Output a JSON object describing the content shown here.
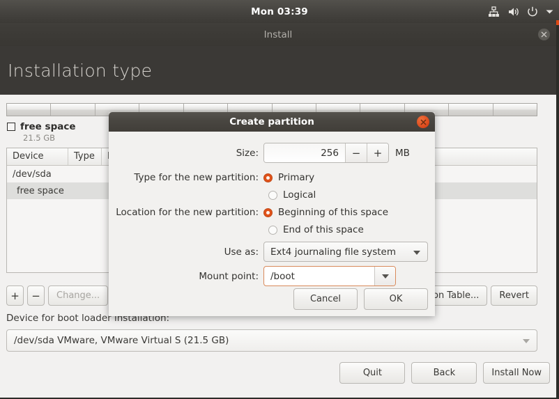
{
  "panel": {
    "clock": "Mon 03:39",
    "tray_icons": [
      "network-icon",
      "volume-icon",
      "power-icon",
      "chevron-down-icon"
    ]
  },
  "window": {
    "title": "Install",
    "close_icon": "close-icon",
    "heading": "Installation type"
  },
  "partition_bar": {
    "segments": 12,
    "free_space_label": "free space",
    "free_space_size": "21.5 GB",
    "checkbox_icon": "checkbox-unchecked-icon"
  },
  "table": {
    "columns": [
      "Device",
      "Type",
      "M"
    ],
    "rows": [
      {
        "device": "/dev/sda",
        "selected": false,
        "child": false
      },
      {
        "device": "free space",
        "selected": true,
        "child": true
      }
    ]
  },
  "toolbar": {
    "add_label": "+",
    "remove_label": "−",
    "change_label": "Change...",
    "new_partition_table_label": "ition Table...",
    "revert_label": "Revert"
  },
  "bootloader": {
    "label": "Device for boot loader installation:",
    "value": "/dev/sda VMware, VMware Virtual S (21.5 GB)",
    "arrow_icon": "chevron-down-icon"
  },
  "nav": {
    "quit": "Quit",
    "back": "Back",
    "install_now": "Install Now"
  },
  "dialog": {
    "title": "Create partition",
    "close_icon": "close-icon",
    "size": {
      "label": "Size:",
      "value": "256",
      "unit": "MB",
      "minus_label": "−",
      "plus_label": "+"
    },
    "type": {
      "label": "Type for the new partition:",
      "options": [
        {
          "label": "Primary",
          "selected": true
        },
        {
          "label": "Logical",
          "selected": false
        }
      ]
    },
    "location": {
      "label": "Location for the new partition:",
      "options": [
        {
          "label": "Beginning of this space",
          "selected": true
        },
        {
          "label": "End of this space",
          "selected": false
        }
      ]
    },
    "use_as": {
      "label": "Use as:",
      "value": "Ext4 journaling file system",
      "arrow_icon": "chevron-down-icon"
    },
    "mount_point": {
      "label": "Mount point:",
      "value": "/boot",
      "arrow_icon": "chevron-down-icon"
    },
    "cancel_label": "Cancel",
    "ok_label": "OK"
  },
  "colors": {
    "accent": "#dd4814",
    "panel_bg": "#464440",
    "heading_bg": "#3b3936",
    "content_bg": "#f2f1f0",
    "focus_border": "#d98a5b"
  }
}
